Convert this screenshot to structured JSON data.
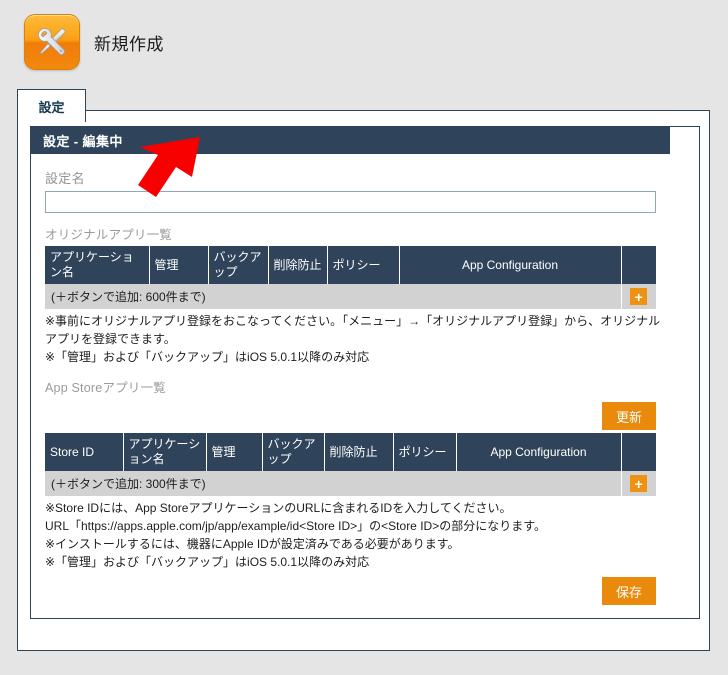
{
  "header": {
    "title": "新規作成",
    "icon": "tools-icon"
  },
  "tabs": [
    {
      "label": "設定",
      "selected": true
    }
  ],
  "panel": {
    "header_title": "設定 - 編集中",
    "form": {
      "name_label": "設定名",
      "name_value": "",
      "name_placeholder": ""
    },
    "original_apps": {
      "caption": "オリジナルアプリ一覧",
      "columns": [
        "アプリケーション名",
        "管理",
        "バックアップ",
        "削除防止",
        "ポリシー",
        "App Configuration",
        ""
      ],
      "add_row_text": "(＋ボタンで追加: 600件まで)",
      "add_button_label": "+",
      "notes": [
        "※事前にオリジナルアプリ登録をおこなってください。「メニュー」→「オリジナルアプリ登録」から、オリジナルアプリを登録できます。",
        "※「管理」および「バックアップ」はiOS 5.0.1以降のみ対応"
      ]
    },
    "appstore_apps": {
      "caption": "App Storeアプリ一覧",
      "update_button_label": "更新",
      "columns": [
        "Store ID",
        "アプリケーション名",
        "管理",
        "バックアップ",
        "削除防止",
        "ポリシー",
        "App Configuration",
        ""
      ],
      "add_row_text": "(＋ボタンで追加: 300件まで)",
      "add_button_label": "+",
      "notes": [
        "※Store IDには、App StoreアプリケーションのURLに含まれるIDを入力してください。",
        "URL「https://apps.apple.com/jp/app/example/id<Store ID>」の<Store ID>の部分になります。",
        "※インストールするには、機器にApple IDが設定済みである必要があります。",
        "※「管理」および「バックアップ」はiOS 5.0.1以降のみ対応"
      ]
    },
    "save_button_label": "保存"
  },
  "annotation": {
    "arrow": "red-arrow-pointing-down-left",
    "color": "#f90000"
  },
  "colors": {
    "page_background": "#e5e5e5",
    "panel_header": "#2f445a",
    "table_header": "#2f445a",
    "accent_orange": "#e98a0c",
    "plus_orange": "#ef9211",
    "border": "#2d4457",
    "muted_text": "#9a9a9a"
  }
}
